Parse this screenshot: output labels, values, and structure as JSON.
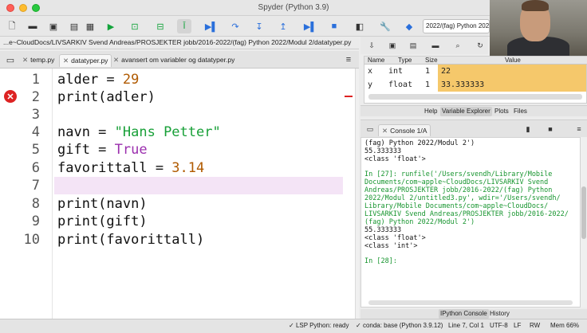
{
  "window": {
    "title": "Spyder (Python 3.9)"
  },
  "toolbar": {
    "path_combo": "2022/(fag) Python 2022"
  },
  "editor": {
    "file_path": "...e~CloudDocs/LIVSARKIV Svend Andreas/PROSJEKTER jobb/2016-2022/(fag) Python 2022/Modul 2/datatyper.py",
    "tabs": [
      "temp.py",
      "datatyper.py",
      "avansert om variabler og datatyper.py"
    ],
    "line_numbers": [
      "1",
      "2",
      "3",
      "4",
      "5",
      "6",
      "7",
      "8",
      "9",
      "10"
    ],
    "code": {
      "l1_var": "alder = ",
      "l1_num": "29",
      "l2": "print(adler)",
      "l4_var": "navn = ",
      "l4_str": "\"Hans Petter\"",
      "l5_var": "gift = ",
      "l5_kw": "True",
      "l6_var": "favorittall = ",
      "l6_num": "3.14",
      "l8": "print(navn)",
      "l9": "print(gift)",
      "l10": "print(favorittall)"
    }
  },
  "variable_explorer": {
    "columns": [
      "Name",
      "Type",
      "Size",
      "Value"
    ],
    "rows": [
      {
        "name": "x",
        "type": "int",
        "size": "1",
        "value": "22"
      },
      {
        "name": "y",
        "type": "float",
        "size": "1",
        "value": "33.333333"
      }
    ]
  },
  "pane_tabs": [
    "Help",
    "Variable Explorer",
    "Plots",
    "Files"
  ],
  "console": {
    "tab_label": "Console 1/A",
    "lines": [
      "(fag) Python 2022/Modul 2')",
      "55.333333",
      "<class 'float'>",
      "",
      "In [27]: runfile('/Users/svendh/Library/Mobile",
      "Documents/com~apple~CloudDocs/LIVSARKIV Svend",
      "Andreas/PROSJEKTER jobb/2016-2022/(fag) Python",
      "2022/Modul 2/untitled3.py', wdir='/Users/svendh/",
      "Library/Mobile Documents/com~apple~CloudDocs/",
      "LIVSARKIV Svend Andreas/PROSJEKTER jobb/2016-2022/",
      "(fag) Python 2022/Modul 2')",
      "55.333333",
      "<class 'float'>",
      "<class 'int'>",
      "",
      "In [28]:"
    ]
  },
  "console_tabs": [
    "IPython Console",
    "History"
  ],
  "status": {
    "lsp": "LSP Python: ready",
    "conda": "conda: base (Python 3.9.12)",
    "position": "Line 7, Col 1",
    "encoding": "UTF-8",
    "eol": "LF",
    "mode": "RW",
    "memory": "Mem 66%"
  }
}
